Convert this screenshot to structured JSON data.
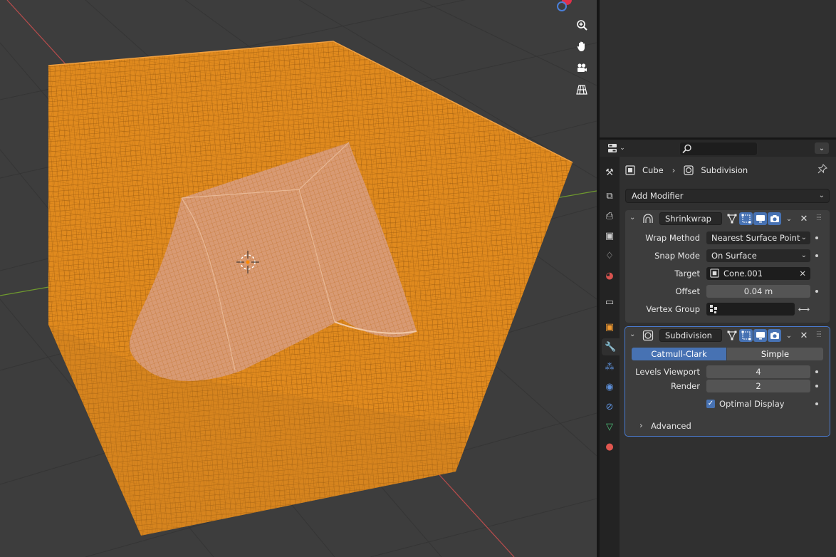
{
  "viewport": {
    "nav_icons": [
      "zoom-icon",
      "hand-pan-icon",
      "camera-icon",
      "perspective-grid-icon"
    ],
    "colors": {
      "background": "#3d3d3d",
      "selection_orange": "#e08a1e",
      "x_axis": "#b84c4c",
      "y_axis": "#6f9a2e"
    }
  },
  "properties": {
    "breadcrumb": {
      "object": "Cube",
      "modifier": "Subdivision"
    },
    "add_modifier_label": "Add Modifier",
    "shrinkwrap": {
      "name": "Shrinkwrap",
      "wrap_method_label": "Wrap Method",
      "wrap_method_value": "Nearest Surface Point",
      "snap_mode_label": "Snap Mode",
      "snap_mode_value": "On Surface",
      "target_label": "Target",
      "target_value": "Cone.001",
      "offset_label": "Offset",
      "offset_value": "0.04 m",
      "vertex_group_label": "Vertex Group",
      "vertex_group_value": ""
    },
    "subdivision": {
      "name": "Subdivision",
      "mode_options": [
        "Catmull-Clark",
        "Simple"
      ],
      "mode_selected": "Catmull-Clark",
      "levels_viewport_label": "Levels Viewport",
      "levels_viewport_value": "4",
      "render_label": "Render",
      "render_value": "2",
      "optimal_display_label": "Optimal Display",
      "optimal_display_checked": true,
      "advanced_label": "Advanced"
    },
    "tabs": [
      "tool-icon",
      "render-icon",
      "output-icon",
      "view-layer-icon",
      "scene-icon",
      "world-icon",
      "collection-icon",
      "object-icon",
      "modifier-icon",
      "particles-icon",
      "physics-icon",
      "constraints-icon",
      "data-icon",
      "material-icon"
    ],
    "colors": {
      "accent_blue": "#4772b3",
      "panel": "#3d3d3d",
      "editor_bg": "#303030"
    }
  }
}
